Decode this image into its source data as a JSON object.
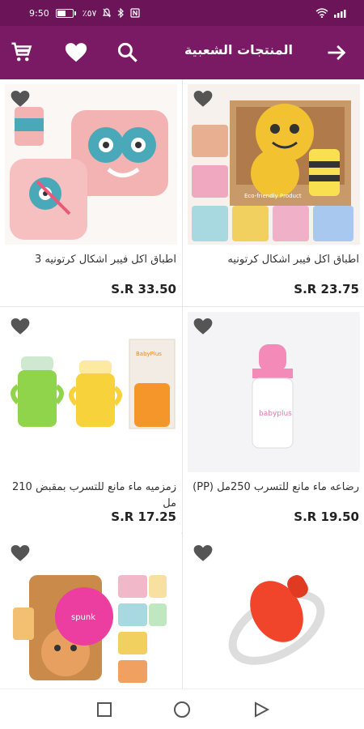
{
  "status_bar": {
    "time": "9:50",
    "battery_percent": "٪٥٧"
  },
  "app_bar": {
    "title": "المنتجات الشعبية"
  },
  "products": [
    {
      "name": "اطباق اكل فيبر اشكال كرتونيه",
      "price": "S.R 23.75"
    },
    {
      "name": "اطباق اكل فيبر اشكال كرتونيه 3",
      "price": "S.R 33.50"
    },
    {
      "name": "رضاعه ماء مانع للتسرب 250مل (PP)",
      "price": "S.R 19.50"
    },
    {
      "name": "زمزميه ماء مانع للتسرب بمقبض 210 مل",
      "price": "S.R 17.25"
    }
  ],
  "promo_badge": {
    "label": "spunk"
  },
  "brand_text": {
    "bottle": "babyplus",
    "box_logo": "BabyPlus",
    "box_caption": "Eco-friendly Product"
  },
  "colors": {
    "primary": "#7a1a65",
    "status": "#6b1457",
    "icon": "#555555"
  },
  "icons": {
    "back": "arrow-right-icon",
    "search": "search-icon",
    "favorites": "heart-icon",
    "cart": "cart-icon",
    "favorite_toggle": "heart-outline-icon"
  }
}
